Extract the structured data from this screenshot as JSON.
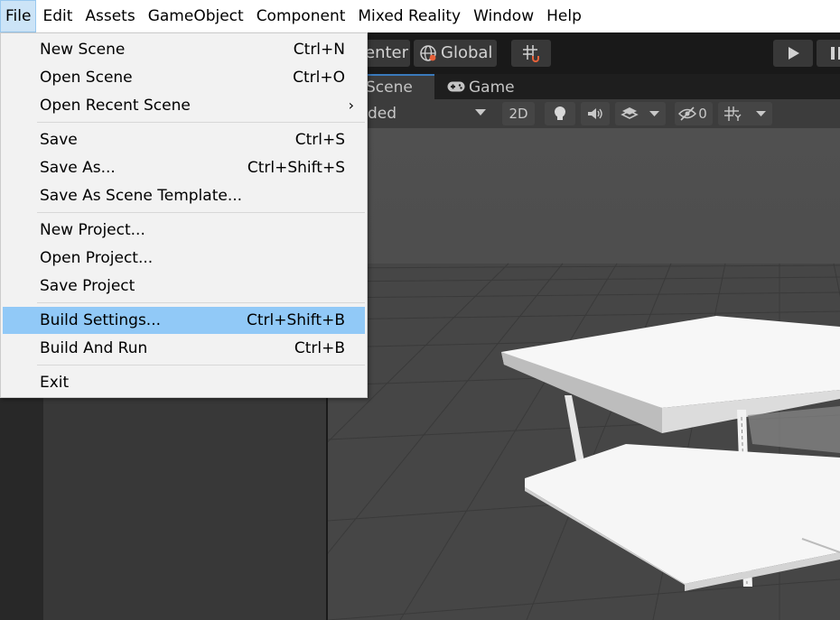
{
  "menubar": {
    "items": [
      "File",
      "Edit",
      "Assets",
      "GameObject",
      "Component",
      "Mixed Reality",
      "Window",
      "Help"
    ]
  },
  "toolbar": {
    "center_label": "enter",
    "global_label": "Global"
  },
  "tabs": {
    "scene": "Scene",
    "game": "Game"
  },
  "scene_toolbar": {
    "draw_mode": "ded",
    "mode_2d": "2D",
    "hidden_count": "0"
  },
  "file_menu": {
    "items": [
      {
        "label": "New Scene",
        "shortcut": "Ctrl+N"
      },
      {
        "label": "Open Scene",
        "shortcut": "Ctrl+O"
      },
      {
        "label": "Open Recent Scene",
        "shortcut": "›"
      },
      {
        "label": "Save",
        "shortcut": "Ctrl+S"
      },
      {
        "label": "Save As...",
        "shortcut": "Ctrl+Shift+S"
      },
      {
        "label": "Save As Scene Template...",
        "shortcut": ""
      },
      {
        "label": "New Project...",
        "shortcut": ""
      },
      {
        "label": "Open Project...",
        "shortcut": ""
      },
      {
        "label": "Save Project",
        "shortcut": ""
      },
      {
        "label": "Build Settings...",
        "shortcut": "Ctrl+Shift+B"
      },
      {
        "label": "Build And Run",
        "shortcut": "Ctrl+B"
      },
      {
        "label": "Exit",
        "shortcut": ""
      }
    ],
    "highlighted_item": "Build Settings..."
  },
  "colors": {
    "menu_highlight": "#91c9f7",
    "menubar_active": "#cce4f7",
    "tab_active_accent": "#3a79bb"
  }
}
